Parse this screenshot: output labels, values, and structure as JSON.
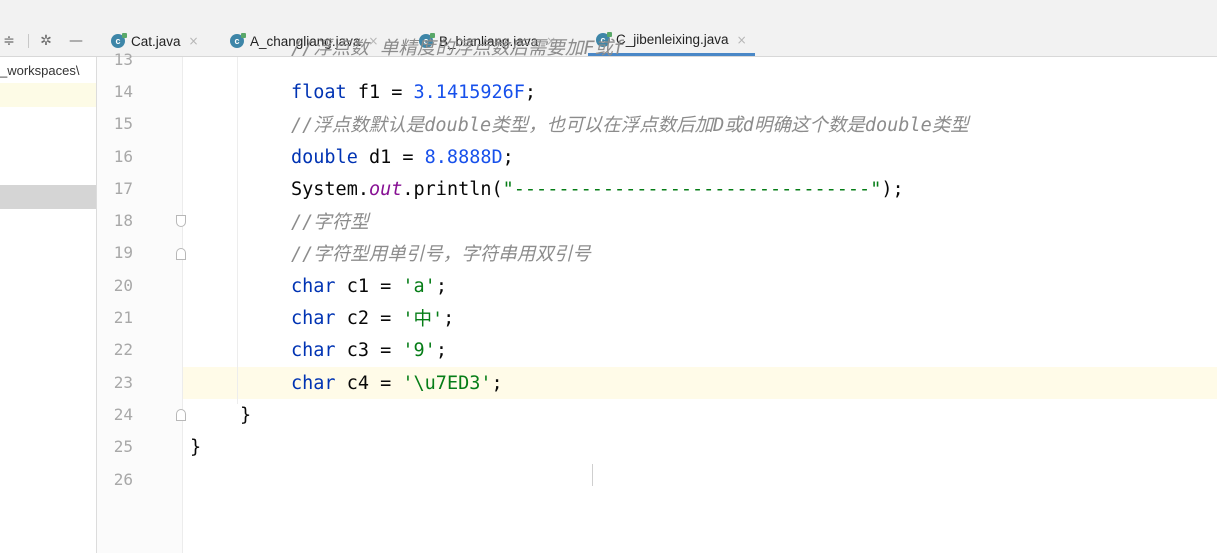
{
  "tabs": [
    {
      "label": "Cat.java",
      "active": false
    },
    {
      "label": "A_changliang.java",
      "active": false
    },
    {
      "label": "B_bianliang.java",
      "active": false
    },
    {
      "label": "C_jibenleixing.java",
      "active": true
    }
  ],
  "tab_icon_letter": "c",
  "tab_close_glyph": "×",
  "toolbar": {
    "layout_icon": "≑",
    "gear_icon": "✲",
    "minimize_icon": "—"
  },
  "project": {
    "root_label": "_workspaces\\"
  },
  "current_line": 23,
  "lines": [
    {
      "num": "13",
      "text": "//浮点数 单精度的浮点数后需要加F或f"
    },
    {
      "num": "14",
      "type_kw": "float",
      "rest": " f1 = ",
      "value": "3.1415926F",
      "end": ";"
    },
    {
      "num": "15",
      "text": "//浮点数默认是double类型，也可以在浮点数后加D或d明确这个数是double类型"
    },
    {
      "num": "16",
      "type_kw": "double",
      "rest": " d1 = ",
      "value": "8.8888D",
      "end": ";"
    },
    {
      "num": "17",
      "obj": "System.",
      "field": "out",
      "method": ".println(",
      "str": "\"--------------------------------\"",
      "end": ");"
    },
    {
      "num": "18",
      "text": "//字符型"
    },
    {
      "num": "19",
      "text": "//字符型用单引号，字符串用双引号"
    },
    {
      "num": "20",
      "type_kw": "char",
      "rest": " c1 = ",
      "value": "'a'",
      "end": ";"
    },
    {
      "num": "21",
      "type_kw": "char",
      "rest": " c2 = ",
      "value": "'中'",
      "end": ";"
    },
    {
      "num": "22",
      "type_kw": "char",
      "rest": " c3 = ",
      "value": "'9'",
      "end": ";"
    },
    {
      "num": "23",
      "type_kw": "char",
      "rest": " c4 = ",
      "value": "'\\u7ED3'",
      "end": ";"
    },
    {
      "num": "24",
      "brace": "}"
    },
    {
      "num": "25",
      "brace": "}"
    },
    {
      "num": "26"
    }
  ]
}
